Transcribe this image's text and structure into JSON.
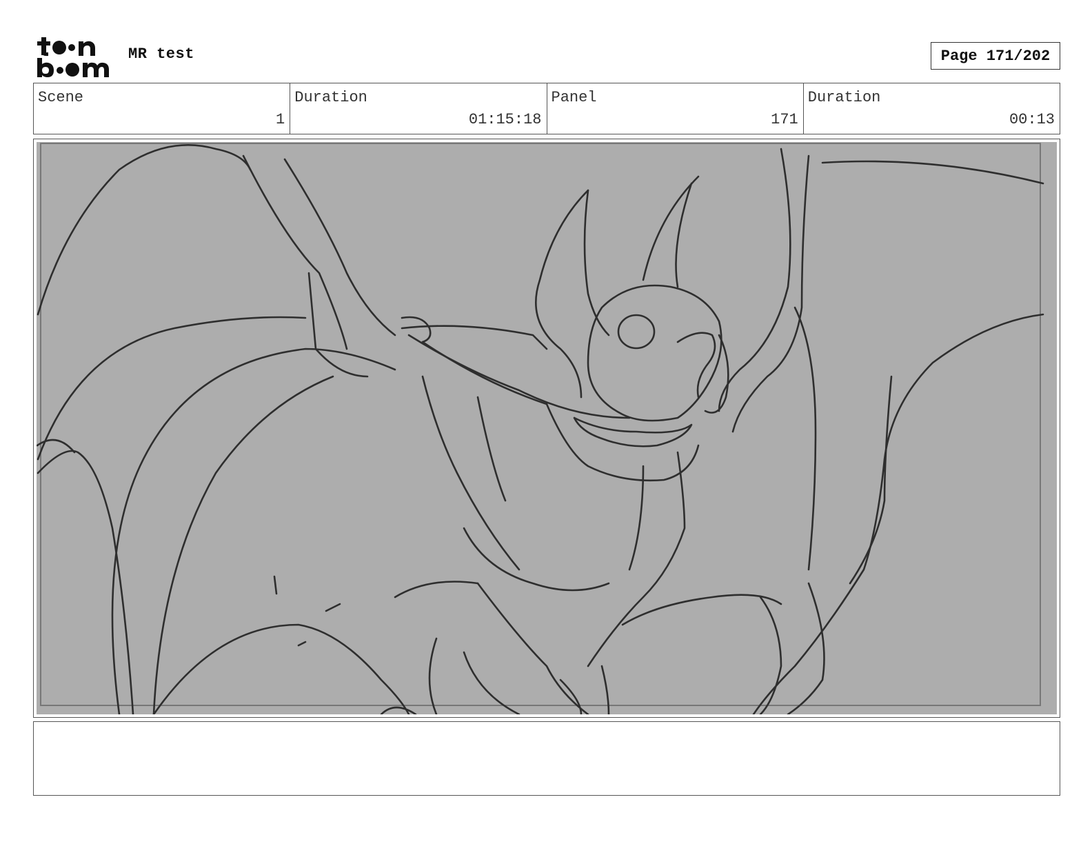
{
  "header": {
    "logo_text": "toon boom",
    "title": "MR test",
    "page_label": "Page 171/202"
  },
  "info": [
    {
      "label": "Scene",
      "value": "1"
    },
    {
      "label": "Duration",
      "value": "01:15:18"
    },
    {
      "label": "Panel",
      "value": "171"
    },
    {
      "label": "Duration",
      "value": "00:13"
    }
  ],
  "panel": {
    "image_description_icon": "sketch-image",
    "background_color": "#adadad",
    "line_color": "#2a2a2a"
  },
  "notes": {
    "text": ""
  }
}
